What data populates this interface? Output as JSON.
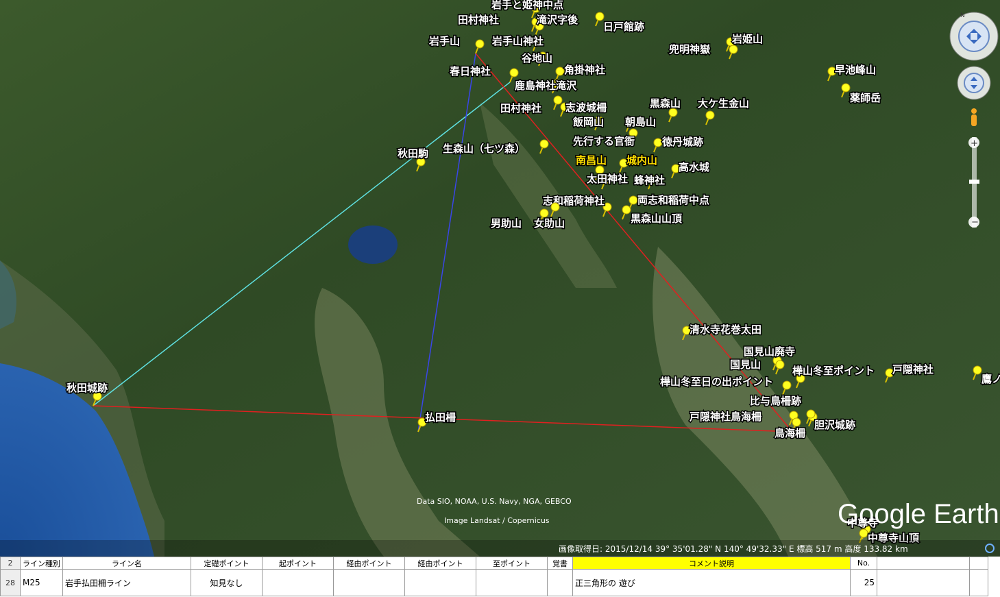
{
  "map": {
    "placemarks": [
      {
        "label": "岩手と姫神中点",
        "highlight": false
      },
      {
        "label": "田村神社",
        "highlight": false
      },
      {
        "label": "滝沢字後",
        "highlight": false
      },
      {
        "label": "日戸館跡",
        "highlight": false
      },
      {
        "label": "岩手山",
        "highlight": false
      },
      {
        "label": "岩手山神社",
        "highlight": false
      },
      {
        "label": "岩姫山",
        "highlight": false
      },
      {
        "label": "兜明神嶽",
        "highlight": false
      },
      {
        "label": "谷地山",
        "highlight": false
      },
      {
        "label": "春日神社",
        "highlight": false
      },
      {
        "label": "角掛神社",
        "highlight": false
      },
      {
        "label": "鹿島神社滝沢",
        "highlight": false
      },
      {
        "label": "早池峰山",
        "highlight": false
      },
      {
        "label": "薬師岳",
        "highlight": false
      },
      {
        "label": "田村神社",
        "highlight": false
      },
      {
        "label": "志波城柵",
        "highlight": false
      },
      {
        "label": "黒森山",
        "highlight": false
      },
      {
        "label": "大ケ生金山",
        "highlight": false
      },
      {
        "label": "飯岡山",
        "highlight": false
      },
      {
        "label": "朝島山",
        "highlight": false
      },
      {
        "label": "先行する官衙",
        "highlight": false
      },
      {
        "label": "徳丹城跡",
        "highlight": false
      },
      {
        "label": "秋田駒",
        "highlight": false
      },
      {
        "label": "生森山（七ツ森）",
        "highlight": false
      },
      {
        "label": "南昌山",
        "highlight": true
      },
      {
        "label": "城内山",
        "highlight": true
      },
      {
        "label": "高水城",
        "highlight": false
      },
      {
        "label": "太田神社",
        "highlight": false
      },
      {
        "label": "蜂神社",
        "highlight": false
      },
      {
        "label": "志和稲荷神社",
        "highlight": false
      },
      {
        "label": "両志和稲荷中点",
        "highlight": false
      },
      {
        "label": "男助山",
        "highlight": false
      },
      {
        "label": "女助山",
        "highlight": false
      },
      {
        "label": "黒森山山頂",
        "highlight": false
      },
      {
        "label": "清水寺花巻太田",
        "highlight": false
      },
      {
        "label": "国見山廃寺",
        "highlight": false
      },
      {
        "label": "国見山",
        "highlight": false
      },
      {
        "label": "樺山冬至ポイント",
        "highlight": false
      },
      {
        "label": "戸隠神社",
        "highlight": false
      },
      {
        "label": "鷹ノ",
        "highlight": false
      },
      {
        "label": "樺山冬至日の出ポイント",
        "highlight": false
      },
      {
        "label": "秋田城跡",
        "highlight": false
      },
      {
        "label": "比与鳥柵跡",
        "highlight": false
      },
      {
        "label": "払田柵",
        "highlight": false
      },
      {
        "label": "戸隠神社鳥海柵",
        "highlight": false
      },
      {
        "label": "胆沢城跡",
        "highlight": false
      },
      {
        "label": "鳥海柵",
        "highlight": false
      },
      {
        "label": "中尊寺",
        "highlight": false
      },
      {
        "label": "中尊寺山頂",
        "highlight": false
      }
    ],
    "lines": [
      {
        "from": "秋田城跡",
        "to": "春日神社",
        "color": "#5fe0e0"
      },
      {
        "from": "払田柵",
        "to": "岩手山",
        "color": "#3a46e8"
      },
      {
        "from": "秋田城跡",
        "to": "鳥海柵",
        "color": "#e02020"
      },
      {
        "from": "岩手山",
        "to": "鳥海柵",
        "color": "#e02020"
      }
    ],
    "credits": [
      "Data SIO, NOAA, U.S. Navy, NGA, GEBCO",
      "Image Landsat / Copernicus"
    ],
    "logo": "Google Earth",
    "status_bar": "画像取得日: 2015/12/14    39° 35'01.28\" N 140° 49'32.33\" E  標高   517 m    高度 133.82 km"
  },
  "sheet": {
    "header_row_num": "2",
    "headers": [
      "ライン種別",
      "ライン名",
      "定礎ポイント",
      "起ポイント",
      "経由ポイント",
      "経由ポイント",
      "至ポイント",
      "覚書",
      "コメント説明",
      "No."
    ],
    "row_num": "28",
    "row": [
      "M25",
      "岩手払田柵ライン",
      "知見なし",
      "",
      "",
      "",
      "",
      "",
      "正三角形の 遊び",
      "25"
    ]
  }
}
